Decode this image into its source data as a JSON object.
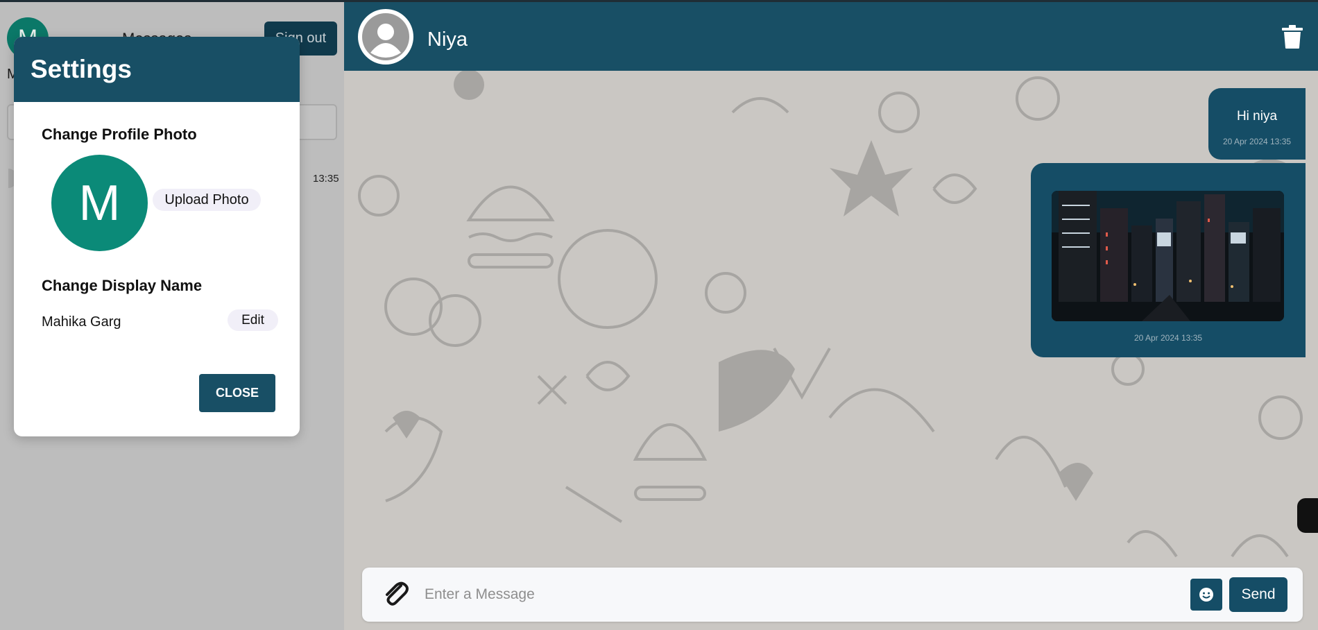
{
  "sidebar": {
    "avatar_letter": "M",
    "title": "Messages",
    "signout_label": "Sign out",
    "subtitle": "M",
    "chat_time": "13:35"
  },
  "chat": {
    "contact_name": "Niya",
    "messages": [
      {
        "text": "Hi niya",
        "time": "20 Apr 2024 13:35"
      },
      {
        "type": "image",
        "time": "20 Apr 2024 13:35"
      }
    ],
    "input_placeholder": "Enter a Message",
    "send_label": "Send"
  },
  "settings": {
    "title": "Settings",
    "profile_photo_heading": "Change Profile Photo",
    "avatar_letter": "M",
    "upload_label": "Upload Photo",
    "display_name_heading": "Change Display Name",
    "display_name": "Mahika Garg",
    "edit_label": "Edit",
    "close_label": "CLOSE"
  },
  "colors": {
    "header": "#184f65",
    "bubble": "#154d66",
    "avatar_green": "#0b8a78",
    "chat_bg": "#cac7c3"
  }
}
